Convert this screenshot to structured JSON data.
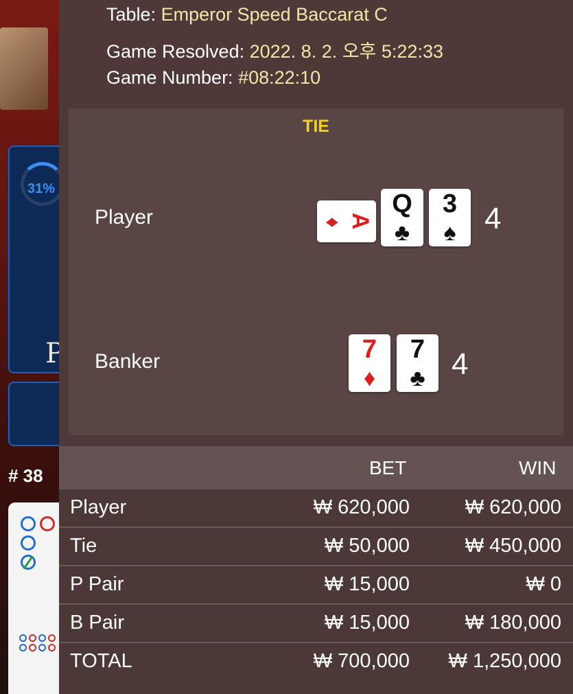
{
  "background": {
    "progress_percent": "31%",
    "player_letter": "P",
    "round_number": "# 38"
  },
  "game_info": {
    "table_label": "Table:",
    "table_value": "Emperor Speed Baccarat C",
    "resolved_label": "Game Resolved:",
    "resolved_value": "2022. 8. 2. 오후 5:22:33",
    "number_label": "Game Number:",
    "number_value": "#08:22:10"
  },
  "result": {
    "outcome": "TIE",
    "player": {
      "label": "Player",
      "score": "4",
      "cards": [
        {
          "rank": "A",
          "suit": "♦",
          "color": "red",
          "orientation": "sideways"
        },
        {
          "rank": "Q",
          "suit": "♣",
          "color": "black",
          "orientation": "upright"
        },
        {
          "rank": "3",
          "suit": "♠",
          "color": "black",
          "orientation": "upright"
        }
      ]
    },
    "banker": {
      "label": "Banker",
      "score": "4",
      "cards": [
        {
          "rank": "7",
          "suit": "♦",
          "color": "red",
          "orientation": "upright"
        },
        {
          "rank": "7",
          "suit": "♣",
          "color": "black",
          "orientation": "upright"
        }
      ]
    }
  },
  "bets": {
    "header_bet": "BET",
    "header_win": "WIN",
    "rows": [
      {
        "label": "Player",
        "bet": "₩ 620,000",
        "win": "₩ 620,000"
      },
      {
        "label": "Tie",
        "bet": "₩ 50,000",
        "win": "₩ 450,000"
      },
      {
        "label": "P Pair",
        "bet": "₩ 15,000",
        "win": "₩ 0"
      },
      {
        "label": "B Pair",
        "bet": "₩ 15,000",
        "win": "₩ 180,000"
      },
      {
        "label": "TOTAL",
        "bet": "₩ 700,000",
        "win": "₩ 1,250,000"
      }
    ]
  },
  "colors": {
    "accent_value": "#f5e6a8",
    "tie_yellow": "#f3d21c",
    "card_red": "#d8211f"
  }
}
